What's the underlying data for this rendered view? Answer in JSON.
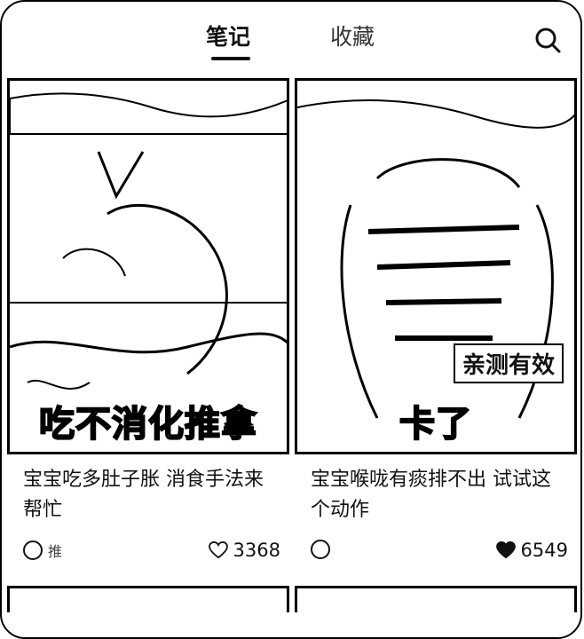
{
  "header": {
    "tabs": [
      {
        "label": "笔记",
        "active": true
      },
      {
        "label": "收藏",
        "active": false
      }
    ],
    "search_icon": "search-icon"
  },
  "cards": [
    {
      "cover_caption": "吃不消化推拿",
      "title": "宝宝吃多肚子胀 消食手法来帮忙",
      "author": "推",
      "likes": "3368",
      "heart_style": "outline"
    },
    {
      "cover_caption": "卡了",
      "cover_badge": "亲测有效",
      "title": "宝宝喉咙有痰排不出 试试这个动作",
      "author": "",
      "likes": "6549",
      "heart_style": "filled"
    }
  ],
  "colors": {
    "text": "#111111",
    "background": "#ffffff",
    "border": "#000000"
  }
}
